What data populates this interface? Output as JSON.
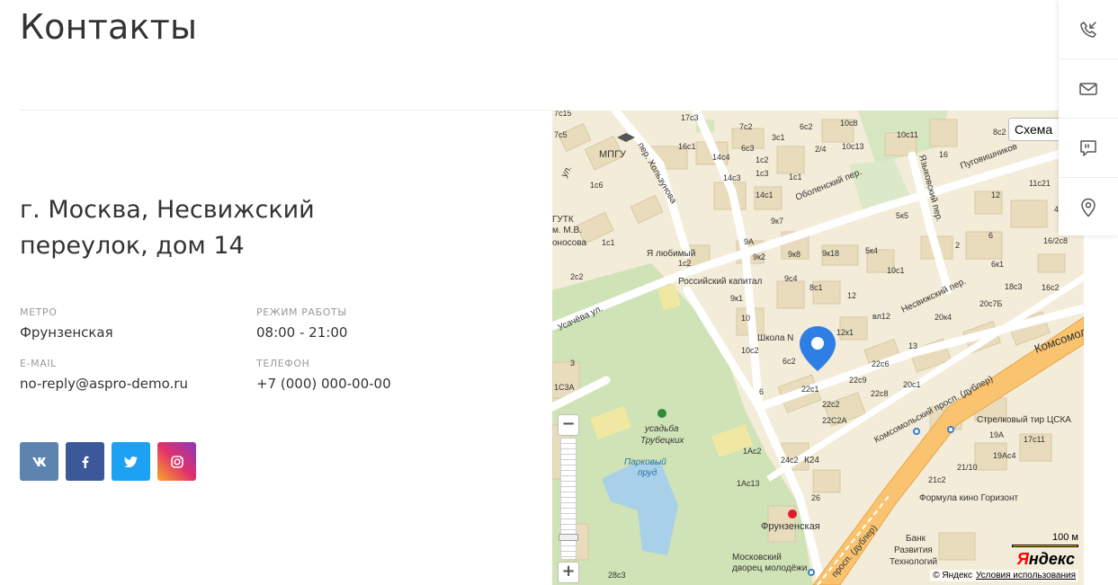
{
  "page": {
    "title": "Контакты"
  },
  "contact": {
    "address": "г. Москва, Несвижский переулок, дом 14",
    "metro": {
      "label": "МЕТРО",
      "value": "Фрунзенская"
    },
    "hours": {
      "label": "РЕЖИМ РАБОТЫ",
      "value": "08:00 - 21:00"
    },
    "email": {
      "label": "E-MAIL",
      "value": "no-reply@aspro-demo.ru"
    },
    "phone": {
      "label": "ТЕЛЕФОН",
      "value": "+7 (000) 000-00-00"
    }
  },
  "socials": [
    {
      "name": "vk",
      "glyph": "vk",
      "color": "#5d84ae"
    },
    {
      "name": "facebook",
      "glyph": "f",
      "color": "#3b5998"
    },
    {
      "name": "twitter",
      "glyph": "t",
      "color": "#1da1f2"
    },
    {
      "name": "instagram",
      "glyph": "ig",
      "color": "#c13584"
    }
  ],
  "map": {
    "type_button": "Схема",
    "scale": "100 м",
    "logo_y": "Я",
    "logo_rest": "ндекс",
    "copyright": "© Яндекс",
    "terms": "Условия использования",
    "zoom_in": "+",
    "zoom_out": "−",
    "labels": {
      "mpgu": "МПГУ",
      "gutk": "ГУТК",
      "mv": "м. М.В.",
      "onosova": "оносова",
      "lyubimy": "Я любимый",
      "russian_capital": "Российский капитал",
      "school": "Школа N",
      "usadba1": "усадьба",
      "usadba2": "Трубецких",
      "pond1": "Парковый",
      "pond2": "пруд",
      "frunzenskaya": "Фрунзенская",
      "mdm1": "Московский",
      "mdm2": "дворец молодёжи",
      "bank1": "Банк",
      "bank2": "Развития",
      "bank3": "Технологий",
      "formula": "Формула кино Горизонт",
      "tir": "Стрелковый тир ЦСКА",
      "k24": "К24",
      "st_hol": "пер. Хользунова",
      "st_obol": "Оболенский пер.",
      "st_yaz": "Языковский пер.",
      "st_pug": "Пуговишников",
      "st_nesv": "Несвижский пер.",
      "st_usach": "Усачёва ул.",
      "st_kom": "Комсомольский просп. (дублер)",
      "st_kom2": "Комсомоль",
      "st_prosp": "просп. (дублер)",
      "st_ul": "ул.",
      "h_17c3": "17с3",
      "h_7c2": "7с2",
      "h_6c2": "6с2",
      "h_10c8": "10с8",
      "h_8c2": "8с2",
      "h_7c15": "7с15",
      "h_7c5": "7с5",
      "h_16c1": "16с1",
      "h_6c3": "6с3",
      "h_3c1": "3с1",
      "h_10c13": "10с13",
      "h_10c11": "10с11",
      "h_14c4": "14с4",
      "h_1c2a": "1с2",
      "h_1c3": "1с3",
      "h_2_4": "2/4",
      "h_16": "16",
      "h_1c6": "1с6",
      "h_14c3": "14с3",
      "h_1c1a": "1с1",
      "h_14c1": "14с1",
      "h_11c21": "11с21",
      "h_12": "12",
      "h_5k5": "5к5",
      "h_9k7": "9к7",
      "h_4": "4",
      "h_1c1b": "1с1",
      "h_9a": "9А",
      "h_16_2c8": "16/2с8",
      "h_9k2": "9к2",
      "h_9k8": "9к8",
      "h_9k18": "9к18",
      "h_5k4": "5к4",
      "h_2": "2",
      "h_6": "6",
      "h_1c2b": "1с2",
      "h_10c1": "10с1",
      "h_6k1": "6к1",
      "h_2c2": "2с2",
      "h_9k1": "9к1",
      "h_9c4": "9с4",
      "h_8c1": "8с1",
      "h_18c3": "18с3",
      "h_16c2": "16с2",
      "h_20c7b": "20с7Б",
      "h_12b": "12",
      "h_vl12": "вл12",
      "h_20k4": "20к4",
      "h_10": "10",
      "h_12k1": "12к1",
      "h_10c2": "10с2",
      "h_13": "13",
      "h_6c2b": "6с2",
      "h_22c6": "22с6",
      "h_3": "3",
      "h_22c9": "22с9",
      "h_22c1": "22с1",
      "h_22c2": "22с2",
      "h_22c8": "22с8",
      "h_20c1": "20с1",
      "h_1c3a": "1С3А",
      "h_22c2a": "22С2А",
      "h_19a": "19А",
      "h_17c11": "17с11",
      "h_1ac2": "1Ас2",
      "h_24c2": "24с2",
      "h_21_10": "21/10",
      "h_19ac4": "19Ас4",
      "h_1ac13": "1Ас13",
      "h_26": "26",
      "h_21c2": "21с2",
      "h_28c3": "28с3",
      "h_6b": "6"
    }
  }
}
